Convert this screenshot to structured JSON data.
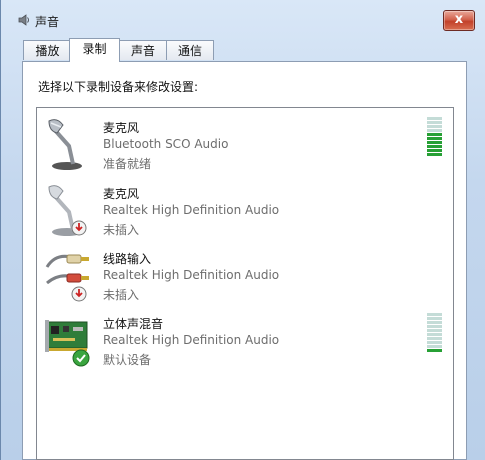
{
  "window": {
    "title": "声音",
    "close_label": "x"
  },
  "tabs": [
    {
      "label": "播放",
      "active": false
    },
    {
      "label": "录制",
      "active": true
    },
    {
      "label": "声音",
      "active": false
    },
    {
      "label": "通信",
      "active": false
    }
  ],
  "instruction": "选择以下录制设备来修改设置:",
  "devices": [
    {
      "name": "麦克风",
      "description": "Bluetooth SCO Audio",
      "status": "准备就绪",
      "icon": "microphone-icon",
      "level_segments": 10,
      "level_lit": 6
    },
    {
      "name": "麦克风",
      "description": "Realtek High Definition Audio",
      "status": "未插入",
      "icon": "microphone-icon",
      "badge": "unplugged-badge"
    },
    {
      "name": "线路输入",
      "description": "Realtek High Definition Audio",
      "status": "未插入",
      "icon": "line-in-cable-icon",
      "badge": "unplugged-badge"
    },
    {
      "name": "立体声混音",
      "description": "Realtek High Definition Audio",
      "status": "默认设备",
      "icon": "sound-card-icon",
      "badge": "default-check-badge",
      "level_segments": 10,
      "level_lit": 1
    }
  ],
  "colors": {
    "meter_on": "#27a035",
    "meter_off": "#c4dcd7",
    "title_bg": "#c4d7ee",
    "close_red": "#c2412a"
  }
}
